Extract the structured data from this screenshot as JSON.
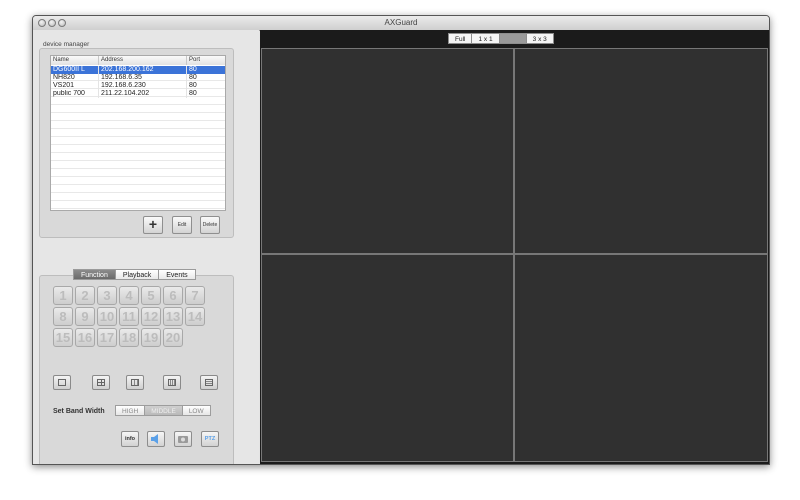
{
  "window": {
    "title": "AXGuard"
  },
  "device_manager": {
    "label": "device manager",
    "columns": [
      "Name",
      "Address",
      "Port"
    ],
    "rows": [
      {
        "name": "DG600II L",
        "address": "202.168.200.162",
        "port": "80",
        "selected": true
      },
      {
        "name": "NH820",
        "address": "192.168.6.35",
        "port": "80"
      },
      {
        "name": "VS201",
        "address": "192.168.6.230",
        "port": "80"
      },
      {
        "name": "public 700",
        "address": "211.22.104.202",
        "port": "80"
      }
    ],
    "buttons": {
      "add": "+",
      "edit": "Edit",
      "delete": "Delete"
    }
  },
  "control_tabs": [
    "Function",
    "Playback",
    "Events"
  ],
  "active_control_tab": "Function",
  "channels": [
    "1",
    "2",
    "3",
    "4",
    "5",
    "6",
    "7",
    "8",
    "9",
    "10",
    "11",
    "12",
    "13",
    "14",
    "15",
    "16",
    "17",
    "18",
    "19",
    "20"
  ],
  "layout_buttons": [
    "1x1-layout-icon",
    "2x2-layout-icon",
    "3x3-layout-icon",
    "4x4-layout-icon",
    "5x5-layout-icon"
  ],
  "bandwidth": {
    "label": "Set Band Width",
    "options": [
      "HIGH",
      "MIDDLE",
      "LOW"
    ],
    "selected": "MIDDLE"
  },
  "tool_buttons": {
    "info": "info",
    "audio": "audio-icon",
    "snapshot": "camera-icon",
    "ptz": "PTZ"
  },
  "view_modes": [
    "Full",
    "1 x 1",
    "2 x 2",
    "3 x 3"
  ],
  "selected_view_mode": "2 x 2",
  "colors": {
    "selection": "#3b73d8",
    "video_bg": "#303030",
    "accent_ptz": "#5aa0e8"
  }
}
